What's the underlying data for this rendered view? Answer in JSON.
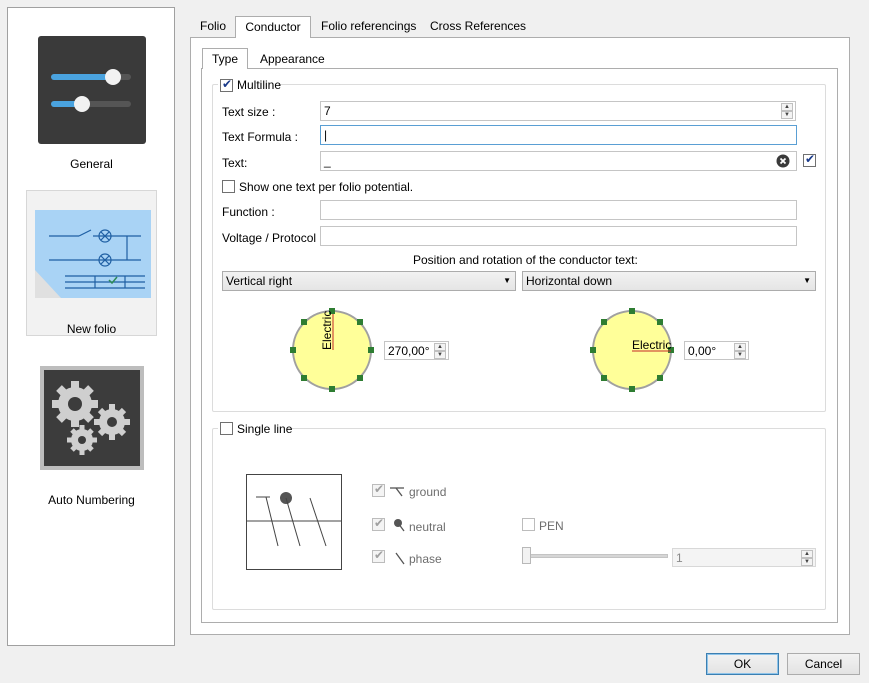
{
  "sidebar": {
    "items": [
      {
        "label": "General",
        "icon": "sliders-icon"
      },
      {
        "label": "New folio",
        "icon": "folio-schematic-icon"
      },
      {
        "label": "Auto Numbering",
        "icon": "gears-icon"
      }
    ]
  },
  "tabs": [
    "Folio",
    "Conductor",
    "Folio referencings",
    "Cross References"
  ],
  "subtabs": [
    "Type",
    "Appearance"
  ],
  "multiline": {
    "label": "Multiline",
    "checked": true,
    "text_size_label": "Text size :",
    "text_size_value": "7",
    "text_formula_label": "Text Formula :",
    "text_formula_value": "|",
    "text_label": "Text:",
    "text_value": "_",
    "show_one_text_label": "Show one text per folio potential.",
    "function_label": "Function :",
    "voltage_label": "Voltage / Protocol :",
    "position_title": "Position and rotation of the conductor text:",
    "vertical_combo": "Vertical right",
    "horizontal_combo": "Horizontal down",
    "dial_text": "Electric",
    "vertical_angle": "270,00°",
    "horizontal_angle": "0,00°"
  },
  "single_line": {
    "label": "Single line",
    "ground": "ground",
    "neutral": "neutral",
    "phase": "phase",
    "pen": "PEN",
    "phase_count": "1"
  },
  "buttons": {
    "ok": "OK",
    "cancel": "Cancel"
  },
  "colors": {
    "dial_fill": "#ffff99",
    "handle": "#2e7d32",
    "accent_border": "#3c7fb1"
  }
}
